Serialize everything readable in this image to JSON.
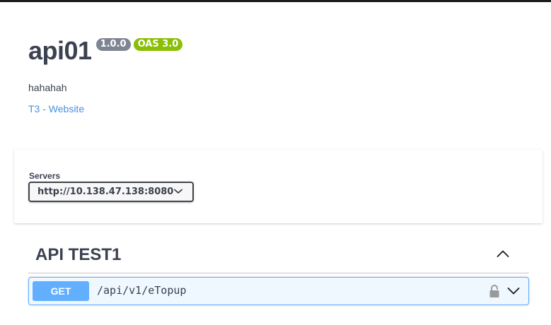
{
  "info": {
    "title": "api01",
    "version": "1.0.0",
    "oas": "OAS 3.0",
    "description": "hahahah",
    "website_link": "T3 - Website"
  },
  "servers": {
    "label": "Servers",
    "selected": "http://10.138.47.138:8080"
  },
  "tag": {
    "name": "API TEST1",
    "expanded": true
  },
  "operations": [
    {
      "method": "GET",
      "path": "/api/v1/eTopup"
    }
  ],
  "colors": {
    "get": "#61affe",
    "oas_badge": "#89bf04",
    "version_badge": "#7d8492",
    "link": "#4990e2"
  },
  "icons": [
    "chevron-down-icon",
    "chevron-up-icon",
    "lock-icon"
  ]
}
